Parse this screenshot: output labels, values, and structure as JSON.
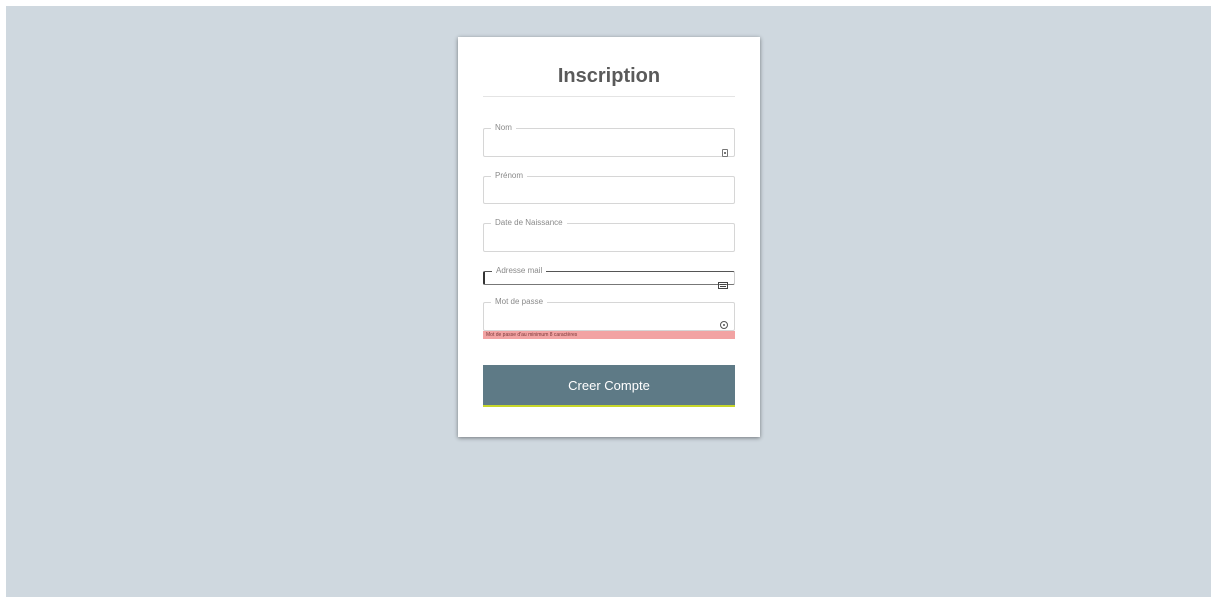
{
  "form": {
    "title": "Inscription",
    "fields": {
      "nom": {
        "label": "Nom",
        "value": ""
      },
      "prenom": {
        "label": "Prénom",
        "value": ""
      },
      "date_naissance": {
        "label": "Date de Naissance",
        "value": ""
      },
      "email": {
        "label": "Adresse mail",
        "value": ""
      },
      "password": {
        "label": "Mot de passe",
        "value": ""
      }
    },
    "password_error": "Mot de passe d'au minimum 8 caractères",
    "submit_label": "Creer Compte"
  },
  "colors": {
    "page_background": "#cfd8df",
    "button": "#5e7a86",
    "button_accent": "#c7d62a",
    "error_background": "#f2a3a3"
  },
  "icons": {
    "nom": "contact-card-icon",
    "email": "address-card-icon",
    "password": "key-icon"
  }
}
